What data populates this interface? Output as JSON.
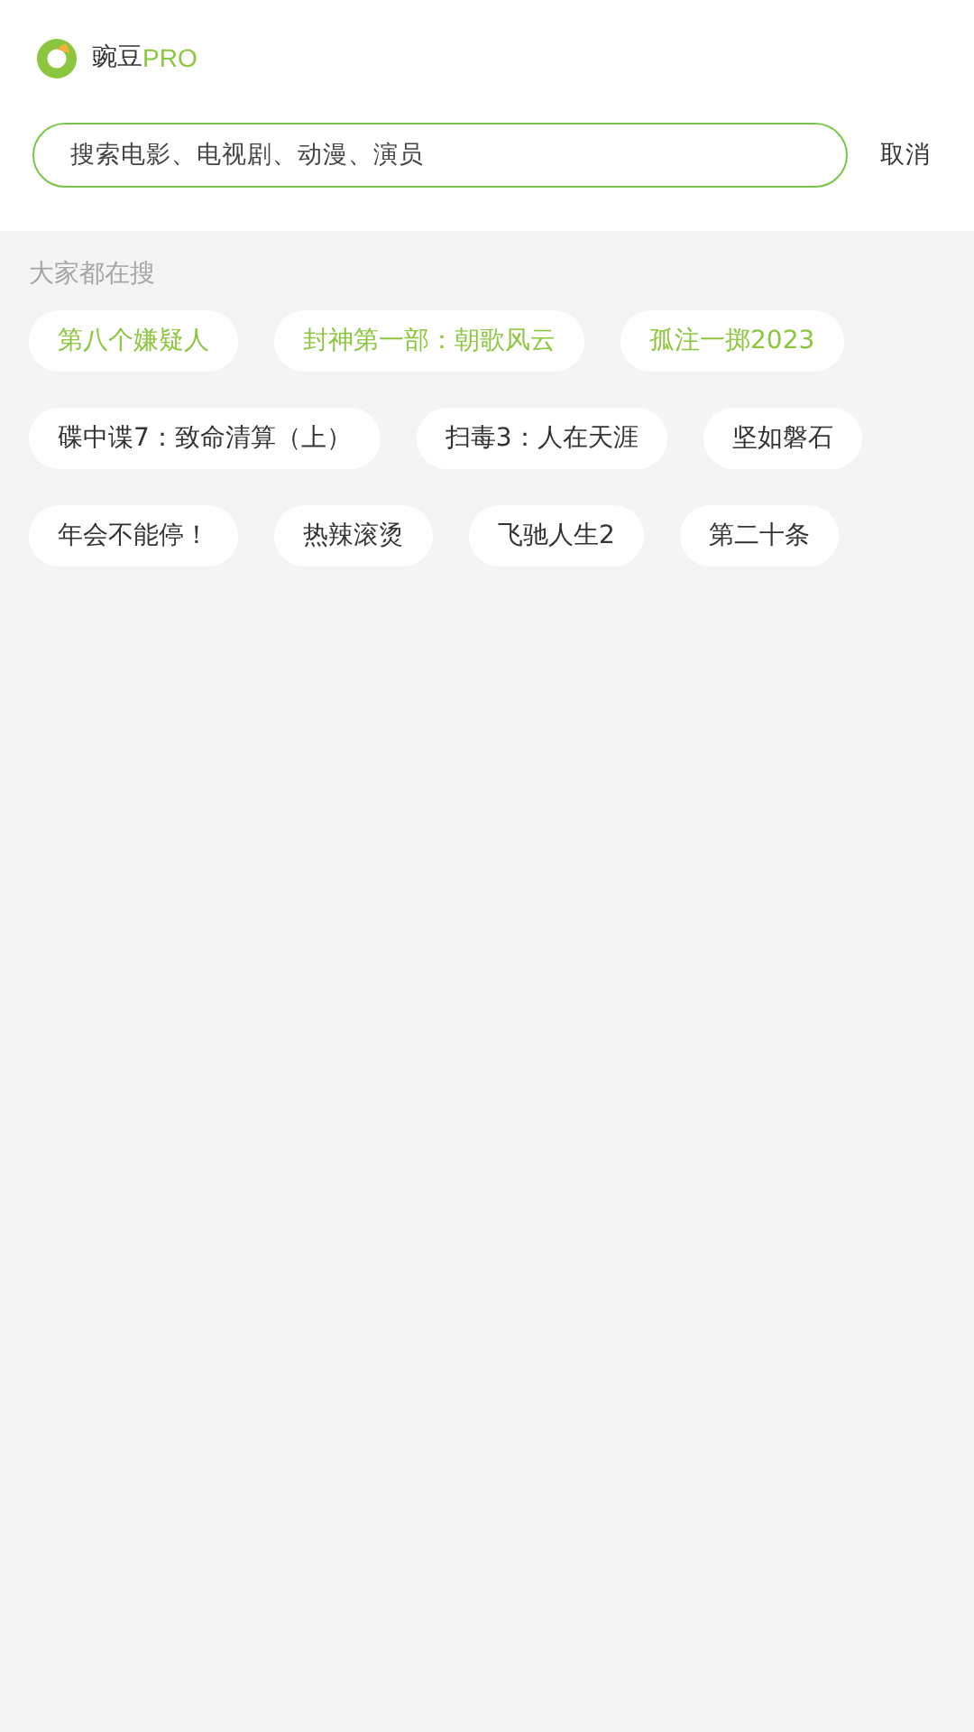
{
  "app": {
    "name": "豌豆",
    "edition": "PRO"
  },
  "search": {
    "placeholder": "搜索电影、电视剧、动漫、演员",
    "cancel": "取消"
  },
  "trending": {
    "title": "大家都在搜",
    "tags": [
      {
        "label": "第八个嫌疑人",
        "hot": true
      },
      {
        "label": "封神第一部：朝歌风云",
        "hot": true
      },
      {
        "label": "孤注一掷2023",
        "hot": true
      },
      {
        "label": "碟中谍7：致命清算（上）",
        "hot": false
      },
      {
        "label": "扫毒3：人在天涯",
        "hot": false
      },
      {
        "label": "坚如磐石",
        "hot": false
      },
      {
        "label": "年会不能停！",
        "hot": false
      },
      {
        "label": "热辣滚烫",
        "hot": false
      },
      {
        "label": "飞驰人生2",
        "hot": false
      },
      {
        "label": "第二十条",
        "hot": false
      }
    ]
  }
}
